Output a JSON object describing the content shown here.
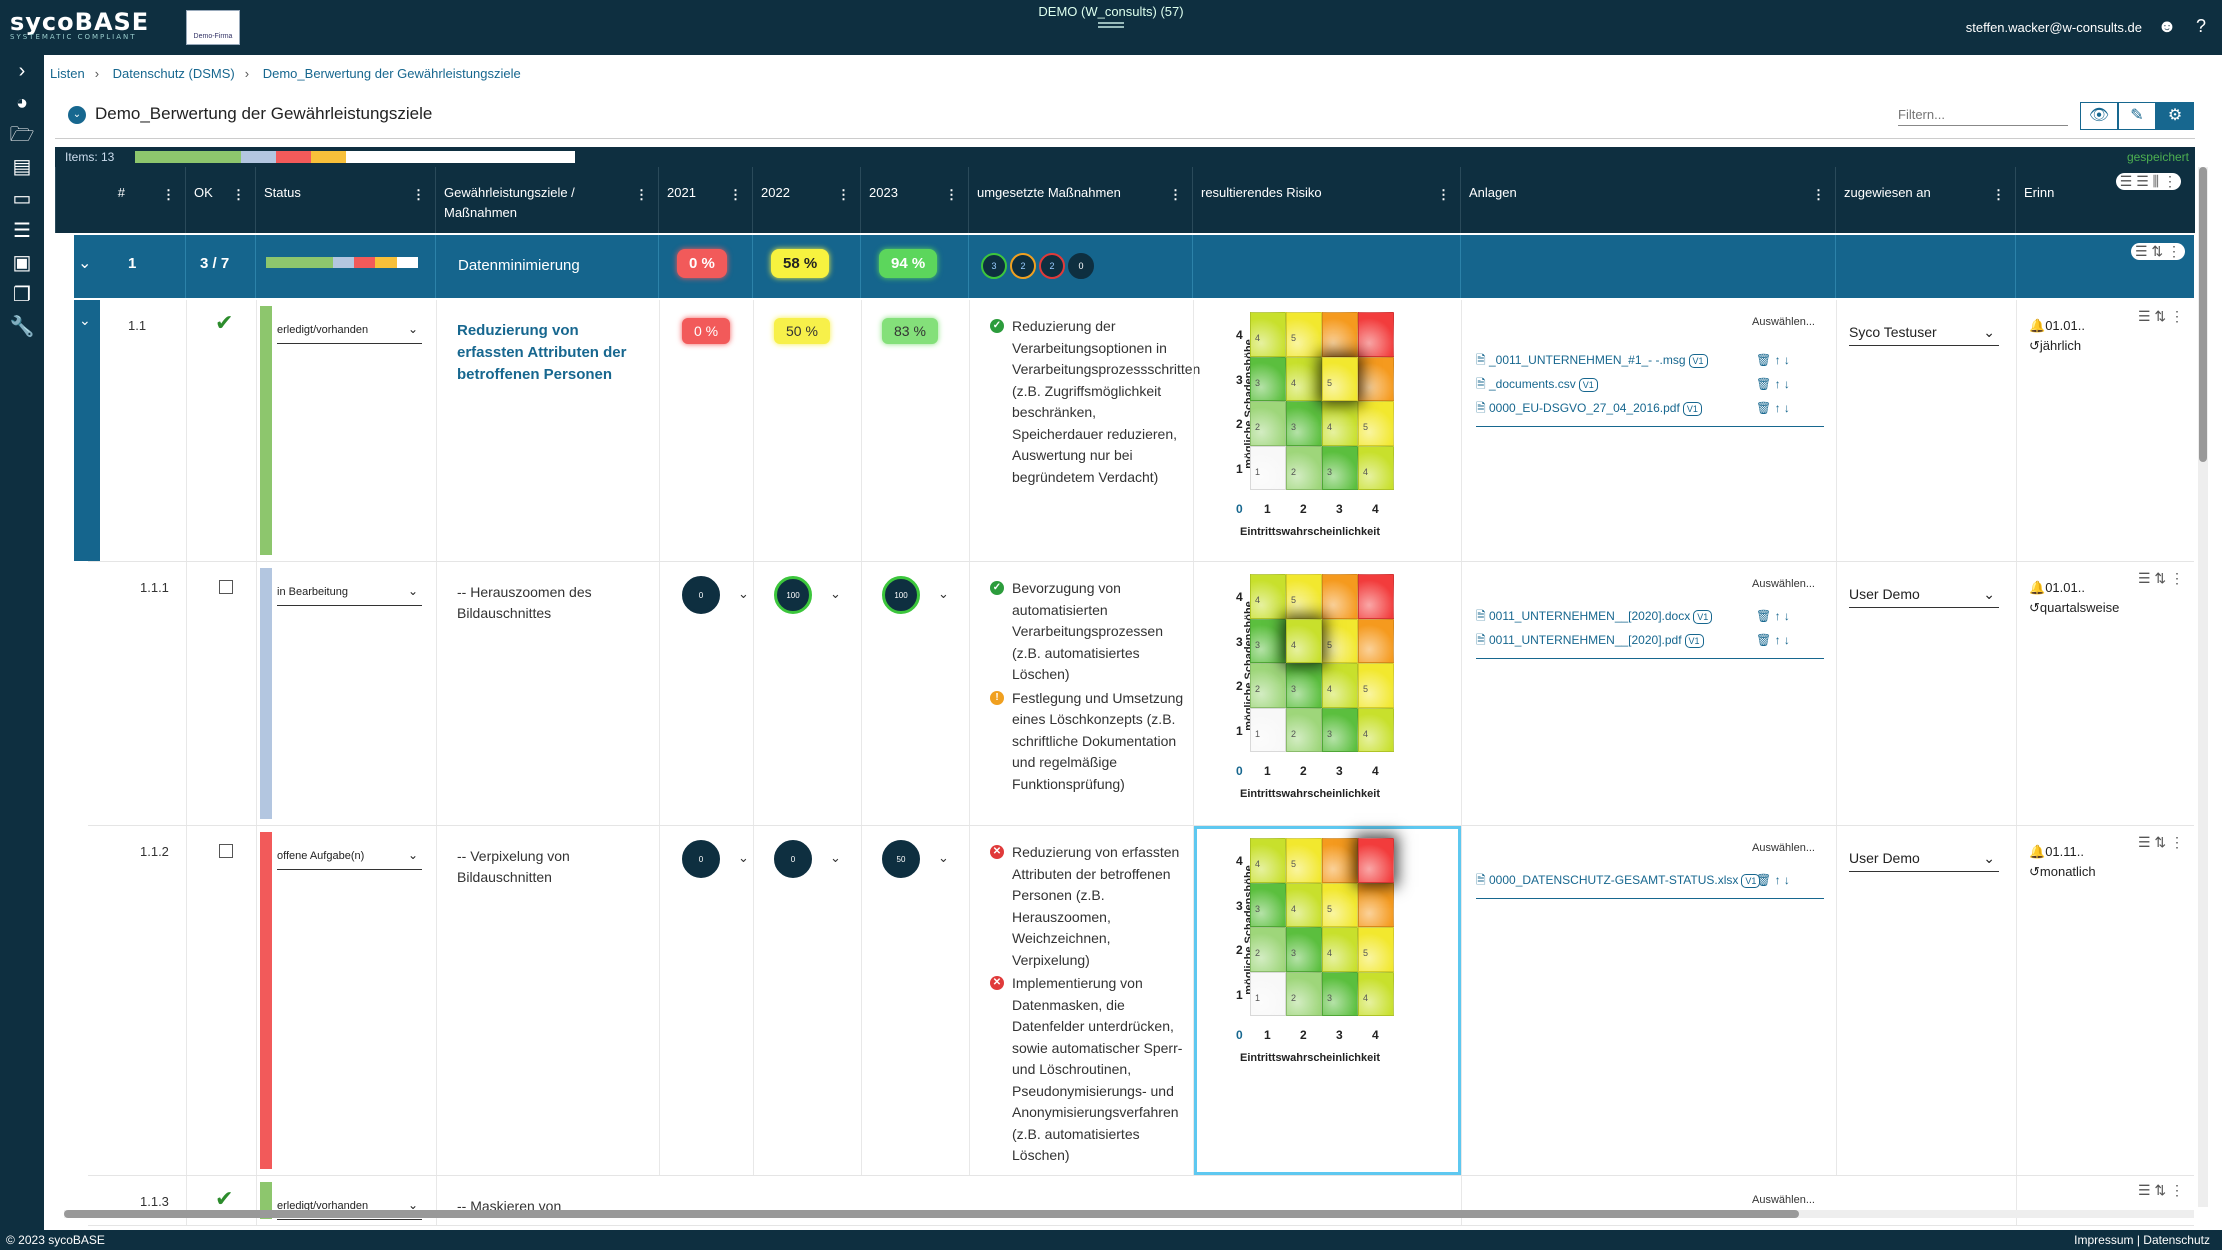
{
  "app": {
    "logo": "sycoBASE",
    "logo_sub": "SYSTEMATIC COMPLIANT",
    "firm_label": "Demo-Firma",
    "tenant": "DEMO (W_consults) (57)",
    "user_email": "steffen.wacker@w-consults.de",
    "footer_left": "© 2023 sycoBASE",
    "footer_right": "Impressum | Datenschutz"
  },
  "breadcrumb": [
    "Listen",
    "Datenschutz (DSMS)",
    "Demo_Berwertung der Gewährleistungsziele"
  ],
  "page": {
    "title": "Demo_Berwertung der Gewährleistungsziele",
    "filter_placeholder": "Filtern...",
    "items_label": "Items: 13",
    "saved_label": "gespeichert",
    "progress": {
      "green": 0.24,
      "lightblue": 0.08,
      "red": 0.08,
      "yellow": 0.08,
      "empty": 0.52
    }
  },
  "columns": {
    "num": "#",
    "ok": "OK",
    "status": "Status",
    "ziele": "Gewährleistungsziele / Maßnahmen",
    "y2021": "2021",
    "y2022": "2022",
    "y2023": "2023",
    "massnahmen": "umgesetzte Maßnahmen",
    "risiko": "resultierendes Risiko",
    "anlagen": "Anlagen",
    "zugewiesen": "zugewiesen an",
    "erinn": "Erinn"
  },
  "group": {
    "num": "1",
    "ok": "3 / 7",
    "title": "Datenminimierung",
    "y2021": "0 %",
    "y2022": "58 %",
    "y2023": "94 %",
    "minis": [
      "3",
      "2",
      "2",
      "0"
    ]
  },
  "matrix": {
    "ylabel": "mögliche Schadenshöhe",
    "xlabel": "Eintrittswahrscheinlichkeit",
    "origin": "0",
    "xticks": [
      "1",
      "2",
      "3",
      "4"
    ],
    "yticks": [
      "4",
      "3",
      "2",
      "1"
    ],
    "cells": [
      [
        "4",
        "5",
        "",
        ""
      ],
      [
        "3",
        "4",
        "5",
        ""
      ],
      [
        "2",
        "3",
        "4",
        "5"
      ],
      [
        "1",
        "2",
        "3",
        "4"
      ]
    ]
  },
  "rows": [
    {
      "num": "1.1",
      "checked": true,
      "status": "erledigt/vorhanden",
      "status_color": "#8dc66d",
      "title": "Reduzierung von erfassten Attributen der betroffenen Personen",
      "y2021": "0 %",
      "y2022": "50 %",
      "y2023": "83 %",
      "measures": [
        {
          "state": "ok",
          "text": "Reduzierung der Verarbeitungsoptionen in Verarbeitungsprozessschritten (z.B. Zugriffsmöglichkeit beschränken, Speicherdauer reduzieren, Auswertung nur bei begründetem Verdacht)"
        }
      ],
      "auswaehlen": "Auswählen...",
      "attachments": [
        {
          "name": "_0011_UNTERNEHMEN_#1_- -.msg",
          "version": "V1"
        },
        {
          "name": "_documents.csv",
          "version": "V1"
        },
        {
          "name": "0000_EU-DSGVO_27_04_2016.pdf",
          "version": "V1"
        }
      ],
      "assignee": "Syco Testuser",
      "reminder_date": "01.01..",
      "reminder_freq": "jährlich"
    },
    {
      "num": "1.1.1",
      "checked": false,
      "status": "in Bearbeitung",
      "status_color": "#b3c6e0",
      "title": "-- Herauszoomen des Bildauschnittes",
      "y2021": "0",
      "y2022": "100",
      "y2023": "100",
      "measures": [
        {
          "state": "ok",
          "text": "Bevorzugung von automatisierten Verarbeitungsprozessen (z.B. automatisiertes Löschen)"
        },
        {
          "state": "warn",
          "text": "Festlegung und Umsetzung eines Löschkonzepts (z.B. schriftliche Dokumentation und regelmäßige Funktionsprüfung)"
        }
      ],
      "auswaehlen": "Auswählen...",
      "attachments": [
        {
          "name": "0011_UNTERNEHMEN__[2020].docx",
          "version": "V1"
        },
        {
          "name": "0011_UNTERNEHMEN__[2020].pdf",
          "version": "V1"
        }
      ],
      "assignee": "User Demo",
      "reminder_date": "01.01..",
      "reminder_freq": "quartalsweise"
    },
    {
      "num": "1.1.2",
      "checked": false,
      "status": "offene Aufgabe(n)",
      "status_color": "#f25a5a",
      "title": "-- Verpixelung von Bildauschnitten",
      "y2021": "0",
      "y2022": "0",
      "y2023": "50",
      "measures": [
        {
          "state": "bad",
          "text": "Reduzierung von erfassten Attributen der betroffenen Personen (z.B. Herauszoomen, Weichzeichnen, Verpixelung)"
        },
        {
          "state": "bad",
          "text": "Implementierung von Datenmasken, die Datenfelder unterdrücken, sowie automatischer Sperr- und Löschroutinen, Pseudonymisierungs- und Anonymisierungsverfahren (z.B. automatisiertes Löschen)"
        }
      ],
      "auswaehlen": "Auswählen...",
      "attachments": [
        {
          "name": "0000_DATENSCHUTZ-GESAMT-STATUS.xlsx",
          "version": "V1"
        }
      ],
      "assignee": "User Demo",
      "reminder_date": "01.11..",
      "reminder_freq": "monatlich"
    },
    {
      "num": "1.1.3",
      "status": "erledigt/vorhanden",
      "title": "-- Maskieren von",
      "auswaehlen": "Auswählen..."
    }
  ]
}
